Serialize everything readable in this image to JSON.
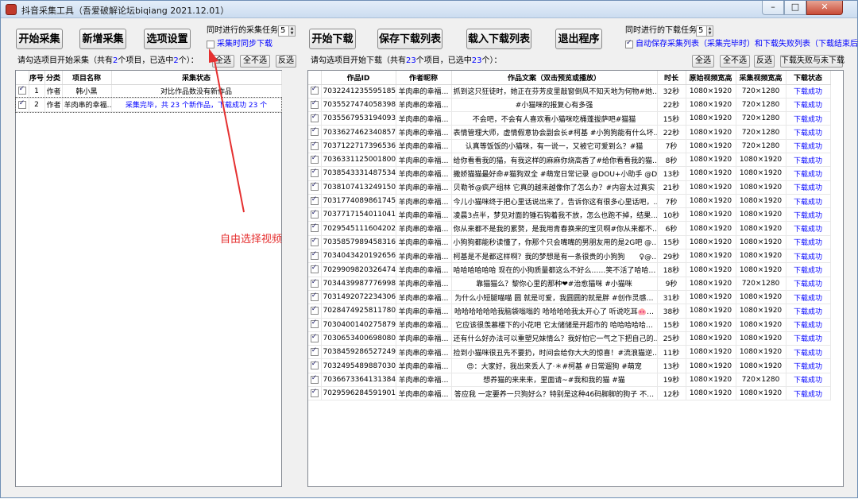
{
  "window": {
    "title": "抖音采集工具（吾爱破解论坛biqiang 2021.12.01）"
  },
  "toolbar_left": {
    "start_collect": "开始采集",
    "add_collect": "新增采集",
    "options": "选项设置",
    "concurrent_collect_label": "同时进行的采集任务数",
    "concurrent_collect_value": "5",
    "sync_download_label": "采集时同步下载"
  },
  "toolbar_right": {
    "start_download": "开始下载",
    "save_list": "保存下载列表",
    "load_list": "载入下载列表",
    "exit": "退出程序",
    "concurrent_download_label": "同时进行的下载任务数",
    "concurrent_download_value": "5",
    "autosave_label": "自动保存采集列表（采集完毕时）和下载失败列表（下载结束后）"
  },
  "left_panel": {
    "info_prefix": "请勾选项目开始采集（共有",
    "info_count": "2",
    "info_mid": "个项目，已选中",
    "info_selected": "2",
    "info_suffix": "个）：",
    "select_all": "全选",
    "deselect_all": "全不选",
    "invert": "反选",
    "columns": [
      "序号",
      "分类",
      "项目名称",
      "采集状态"
    ],
    "rows": [
      {
        "checked": true,
        "no": "1",
        "cat": "作者",
        "name": "韩小黑",
        "status": "对比作品数没有新作品",
        "status_blue": false
      },
      {
        "checked": true,
        "no": "2",
        "cat": "作者",
        "name": "羊肉串的幸福…",
        "status": "采集完毕，共 23 个新作品，下载成功 23 个",
        "status_blue": true
      }
    ]
  },
  "right_panel": {
    "info_prefix": "请勾选项目开始下载（共有",
    "info_count": "23",
    "info_mid": "个项目，已选中",
    "info_selected": "23",
    "info_suffix": "个）：",
    "select_all": "全选",
    "deselect_all": "全不选",
    "invert": "反选",
    "failed_unfinished": "下载失败与未下载",
    "columns": [
      "作品ID",
      "作者昵称",
      "作品文案（双击预览或播放）",
      "时长",
      "原始视频宽高",
      "采集视频宽高",
      "下载状态"
    ],
    "rows": [
      {
        "id": "7032241235595185422",
        "author": "羊肉串的幸福…",
        "text": "抓到这只狂徒时，她正在芬芳皮里敲窗倒风不知天地为何物#她…",
        "dur": "32秒",
        "orig": "1080×1920",
        "col": "720×1280",
        "status": "下载成功"
      },
      {
        "id": "7035527474058398990",
        "author": "羊肉串的幸福…",
        "text": "#小猫咪的报复心有多强",
        "dur": "22秒",
        "orig": "1080×1920",
        "col": "720×1280",
        "status": "下载成功"
      },
      {
        "id": "7035567953194093855",
        "author": "羊肉串的幸福…",
        "text": "不会吧，不会有人喜欢看小猫咪吃桶蓬拔萨吧#猫猫",
        "dur": "15秒",
        "orig": "1080×1920",
        "col": "720×1280",
        "status": "下载成功"
      },
      {
        "id": "7033627462340857101",
        "author": "羊肉串的幸福…",
        "text": "表情管理大师，虚情假意协会副会长#柯基 #小狗狗能有什么坏…",
        "dur": "22秒",
        "orig": "1080×1920",
        "col": "720×1280",
        "status": "下载成功"
      },
      {
        "id": "7037122717396536590",
        "author": "羊肉串的幸福…",
        "text": "认真等饭饭的小猫咪，有一说一，又被它可爱到么？#猫",
        "dur": "7秒",
        "orig": "1080×1920",
        "col": "720×1280",
        "status": "下载成功"
      },
      {
        "id": "7036331125001800990",
        "author": "羊肉串的幸福…",
        "text": "给你看看我的猫，有我这样的麻麻你烧高香了#给你看看我的猫…",
        "dur": "8秒",
        "orig": "1080×1920",
        "col": "1080×1920",
        "status": "下载成功"
      },
      {
        "id": "7038543331487534350",
        "author": "羊肉串的幸福…",
        "text": "撒娇猫猫最好命#猫狗双全 #萌宠日常记录 @DOU+小助手 @DOU…",
        "dur": "13秒",
        "orig": "1080×1920",
        "col": "1080×1920",
        "status": "下载成功"
      },
      {
        "id": "7038107413249150239",
        "author": "羊肉串的幸福…",
        "text": "贝勒爷@疯产组林  它真的越来越像你了怎么办？#内容太过真实",
        "dur": "21秒",
        "orig": "1080×1920",
        "col": "1080×1920",
        "status": "下载成功"
      },
      {
        "id": "7031774089861745951",
        "author": "羊肉串的幸福…",
        "text": "今儿小猫咪终于把心里话说出来了，告诉你这有很多心里话吧，…",
        "dur": "7秒",
        "orig": "1080×1920",
        "col": "1080×1920",
        "status": "下载成功"
      },
      {
        "id": "7037717154011041038",
        "author": "羊肉串的幸福…",
        "text": "凌晨3点半，梦见对面的锤石钩着我不放，怎么也跑不掉，结果…",
        "dur": "10秒",
        "orig": "1080×1920",
        "col": "1080×1920",
        "status": "下载成功"
      },
      {
        "id": "7029545111604202783",
        "author": "羊肉串的幸福…",
        "text": "你从来都不是我的累赘，是我用青春换来的宝贝啊#你从来都不…",
        "dur": "6秒",
        "orig": "1080×1920",
        "col": "1080×1920",
        "status": "下载成功"
      },
      {
        "id": "7035857989458316581",
        "author": "羊肉串的幸福…",
        "text": "小狗狗都能秒读懂了，你那个只会嘴嘴的男朋友用的是2G吧 @…",
        "dur": "15秒",
        "orig": "1080×1920",
        "col": "1080×1920",
        "status": "下载成功"
      },
      {
        "id": "7034043420192656677",
        "author": "羊肉串的幸福…",
        "text": "柯基是不是都这样啊？我的梦想是有一条很贵的小狗狗　　♀@…",
        "dur": "29秒",
        "orig": "1080×1920",
        "col": "1080×1920",
        "status": "下载成功"
      },
      {
        "id": "7029909820326474084",
        "author": "羊肉串的幸福…",
        "text": "哈哈哈哈哈哈  现在的小狗质量都这么不好么……笑不活了哈哈…",
        "dur": "18秒",
        "orig": "1080×1920",
        "col": "1080×1920",
        "status": "下载成功"
      },
      {
        "id": "7034439987776998686",
        "author": "羊肉串的幸福…",
        "text": "靠猫猫么？黎你心里的那种❤#治愈猫咪 #小猫咪",
        "dur": "9秒",
        "orig": "1080×1920",
        "col": "720×1280",
        "status": "下载成功"
      },
      {
        "id": "7031492072234306853",
        "author": "羊肉串的幸福…",
        "text": "为什么小短腿喵喵  圆  就是可爱，我圆圆的就是胖  #创作灵感…",
        "dur": "31秒",
        "orig": "1080×1920",
        "col": "1080×1920",
        "status": "下载成功"
      },
      {
        "id": "7028474925811780871",
        "author": "羊肉串的幸福…",
        "text": "哈哈哈哈哈哈我脑袋嗡嗡的  哈哈哈哈我太开心了  听说吃耳🐽…",
        "dur": "38秒",
        "orig": "1080×1920",
        "col": "1080×1920",
        "status": "下载成功"
      },
      {
        "id": "7030400140275879199",
        "author": "羊肉串的幸福…",
        "text": "它应该很羡慕楼下的小花吧  它太储储是开超市的  哈哈哈哈哈…",
        "dur": "15秒",
        "orig": "1080×1920",
        "col": "1080×1920",
        "status": "下载成功"
      },
      {
        "id": "7030653400698080519",
        "author": "羊肉串的幸福…",
        "text": "还有什么好办法可以重塑兄妹情么？我好怕它一气之下把自己的…",
        "dur": "25秒",
        "orig": "1080×1920",
        "col": "1080×1920",
        "status": "下载成功"
      },
      {
        "id": "7038459286527249671",
        "author": "羊肉串的幸福…",
        "text": "捡到小猫咪很丑先不要扔，时间会给你大大的惊喜！#流浪猫逆…",
        "dur": "11秒",
        "orig": "1080×1920",
        "col": "1080×1920",
        "status": "下载成功"
      },
      {
        "id": "7032495489887030565",
        "author": "羊肉串的幸福…",
        "text": "😍：大家好，我出来丢人了·＊#柯基 #日常遛狗 #萌宠",
        "dur": "13秒",
        "orig": "1080×1920",
        "col": "1080×1920",
        "status": "下载成功"
      },
      {
        "id": "7036673364131384590",
        "author": "羊肉串的幸福…",
        "text": "想养猫的来来来，里面请~#我和我的猫 #猫",
        "dur": "19秒",
        "orig": "1080×1920",
        "col": "720×1280",
        "status": "下载成功"
      },
      {
        "id": "7029596284591901959",
        "author": "羊肉串的幸福…",
        "text": "答应我  一定要养一只狗好么？特别是这种46码脚脚的狗子  不…",
        "dur": "12秒",
        "orig": "1080×1920",
        "col": "1080×1920",
        "status": "下载成功"
      }
    ]
  },
  "annotation": {
    "text": "自由选择视频",
    "color": "#e53030"
  }
}
